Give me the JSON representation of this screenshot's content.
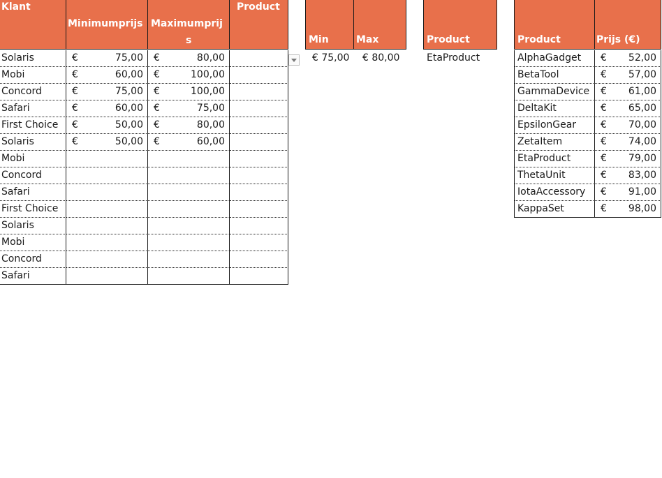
{
  "colors": {
    "header_bg": "#E8704B",
    "header_text": "#FFFFFF",
    "grid_border": "#1A1A1A"
  },
  "left_table": {
    "headers": {
      "klant": "Klant",
      "min": "Minimumprijs",
      "max_part1": "Maximumprij",
      "max_part2": "s",
      "product": "Product"
    },
    "rows": [
      {
        "klant": "Solaris",
        "min_cur": "€",
        "min": "75,00",
        "max_cur": "€",
        "max": "80,00"
      },
      {
        "klant": "Mobi",
        "min_cur": "€",
        "min": "60,00",
        "max_cur": "€",
        "max": "100,00"
      },
      {
        "klant": "Concord",
        "min_cur": "€",
        "min": "75,00",
        "max_cur": "€",
        "max": "100,00"
      },
      {
        "klant": "Safari",
        "min_cur": "€",
        "min": "60,00",
        "max_cur": "€",
        "max": "75,00"
      },
      {
        "klant": "First Choice",
        "min_cur": "€",
        "min": "50,00",
        "max_cur": "€",
        "max": "80,00"
      },
      {
        "klant": "Solaris",
        "min_cur": "€",
        "min": "50,00",
        "max_cur": "€",
        "max": "60,00"
      },
      {
        "klant": "Mobi"
      },
      {
        "klant": "Concord"
      },
      {
        "klant": "Safari"
      },
      {
        "klant": "First Choice"
      },
      {
        "klant": "Solaris"
      },
      {
        "klant": "Mobi"
      },
      {
        "klant": "Concord"
      },
      {
        "klant": "Safari"
      }
    ]
  },
  "dropdown_icon": "chevron-down-icon",
  "middle": {
    "headers": {
      "min": "Min",
      "max": "Max",
      "product": "Product"
    },
    "values": {
      "min": "€ 75,00",
      "max": "€ 80,00",
      "product": "EtaProduct"
    }
  },
  "right_table": {
    "headers": {
      "product": "Product",
      "price": "Prijs (€)"
    },
    "rows": [
      {
        "product": "AlphaGadget",
        "cur": "€",
        "price": "52,00"
      },
      {
        "product": "BetaTool",
        "cur": "€",
        "price": "57,00"
      },
      {
        "product": "GammaDevice",
        "cur": "€",
        "price": "61,00"
      },
      {
        "product": "DeltaKit",
        "cur": "€",
        "price": "65,00"
      },
      {
        "product": "EpsilonGear",
        "cur": "€",
        "price": "70,00"
      },
      {
        "product": "ZetaItem",
        "cur": "€",
        "price": "74,00"
      },
      {
        "product": "EtaProduct",
        "cur": "€",
        "price": "79,00"
      },
      {
        "product": "ThetaUnit",
        "cur": "€",
        "price": "83,00"
      },
      {
        "product": "IotaAccessory",
        "cur": "€",
        "price": "91,00"
      },
      {
        "product": "KappaSet",
        "cur": "€",
        "price": "98,00"
      }
    ]
  }
}
